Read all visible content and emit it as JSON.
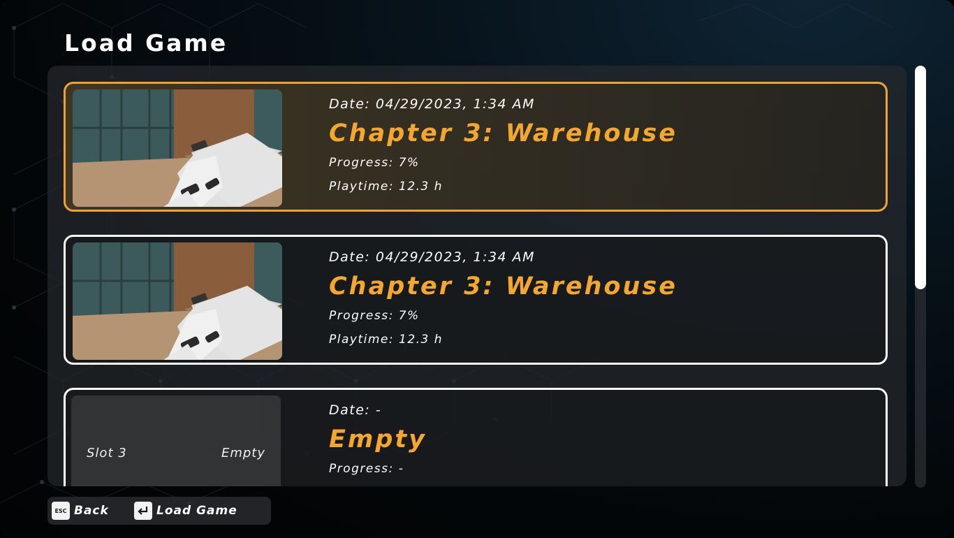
{
  "screen_title": "Load Game",
  "slots": [
    {
      "date_label": "Date:",
      "date": "04/29/2023, 1:34 AM",
      "chapter": "Chapter 3: Warehouse",
      "progress_label": "Progress:",
      "progress": "7%",
      "playtime_label": "Playtime:",
      "playtime": "12.3 h",
      "selected": true
    },
    {
      "date_label": "Date:",
      "date": "04/29/2023, 1:34 AM",
      "chapter": "Chapter 3: Warehouse",
      "progress_label": "Progress:",
      "progress": "7%",
      "playtime_label": "Playtime:",
      "playtime": "12.3 h",
      "selected": false
    },
    {
      "slot_label": "Slot 3",
      "empty_label": "Empty",
      "date_label": "Date:",
      "date": "-",
      "chapter": "Empty",
      "progress_label": "Progress:",
      "progress": "-",
      "selected": false
    }
  ],
  "scrollbar": {
    "visible_fraction": 0.53
  },
  "footer": {
    "back_key": "ESC",
    "back_label": "Back",
    "load_key_icon": "enter-key-icon",
    "load_label": "Load Game"
  },
  "colors": {
    "accent": "#f4a72e",
    "selected_border": "#f1a22e",
    "text": "#ffffff",
    "panel": "#26282c"
  }
}
